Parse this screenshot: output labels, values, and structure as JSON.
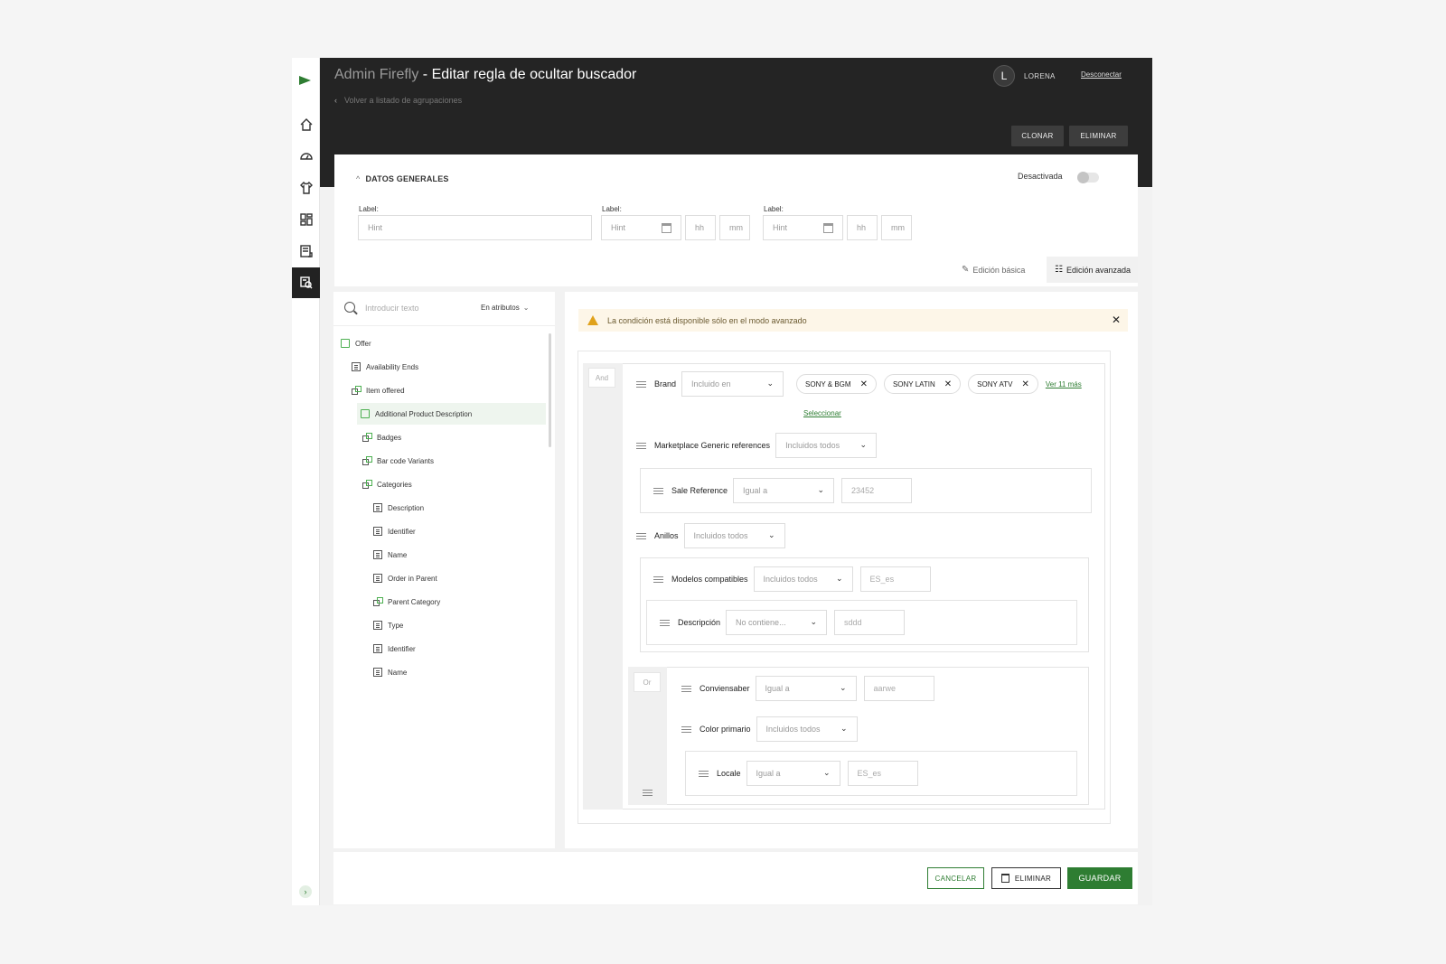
{
  "header": {
    "app_name": "Admin Firefly",
    "title": " - Editar regla de ocultar buscador",
    "back_link": "Volver a listado de agrupaciones",
    "avatar_initial": "L",
    "user_name": "LORENA",
    "logout": "Desconectar",
    "clone_button": "CLONAR",
    "delete_button": "ELIMINAR"
  },
  "general": {
    "section_title": "DATOS GENERALES",
    "toggle_label": "Desactivada",
    "toggle_on": false,
    "fields": [
      {
        "label": "Label:",
        "placeholder": "Hint"
      },
      {
        "label": "Label:",
        "placeholder": "Hint",
        "hh": "hh",
        "mm": "mm"
      },
      {
        "label": "Label:",
        "placeholder": "Hint",
        "hh": "hh",
        "mm": "mm"
      }
    ],
    "tabs": {
      "basic": "Edición básica",
      "advanced": "Edición avanzada",
      "active": "advanced"
    }
  },
  "tree": {
    "search_placeholder": "Introducir texto",
    "filter": "En atributos",
    "items": [
      {
        "label": "Offer",
        "icon": "folder-icon"
      },
      {
        "label": "Availability Ends",
        "icon": "document-icon"
      },
      {
        "label": "Item offered",
        "icon": "link-icon"
      },
      {
        "label": "Additional Product Description",
        "icon": "folder-icon",
        "selected": true
      },
      {
        "label": "Badges",
        "icon": "link-icon"
      },
      {
        "label": "Bar code Variants",
        "icon": "link-icon"
      },
      {
        "label": "Categories",
        "icon": "link-icon"
      },
      {
        "label": "Description",
        "icon": "document-icon"
      },
      {
        "label": "Identifier",
        "icon": "document-icon"
      },
      {
        "label": "Name",
        "icon": "document-icon"
      },
      {
        "label": "Order in Parent",
        "icon": "document-icon"
      },
      {
        "label": "Parent Category",
        "icon": "link-icon"
      },
      {
        "label": "Type",
        "icon": "document-icon"
      },
      {
        "label": "Identifier",
        "icon": "document-icon"
      },
      {
        "label": "Name",
        "icon": "document-icon"
      }
    ]
  },
  "conditions": {
    "alert": "La condición está disponible sólo en el modo avanzado",
    "and_label": "And",
    "or_label": "Or",
    "brand": {
      "label": "Brand",
      "operator": "Incluido en",
      "chips": [
        "SONY & BGM",
        "SONY LATIN",
        "SONY ATV"
      ],
      "more": "Ver 11 más",
      "select_link": "Seleccionar"
    },
    "marketplace": {
      "label": "Marketplace Generic references",
      "operator": "Incluidos todos"
    },
    "sale_reference": {
      "label": "Sale Reference",
      "operator": "Igual a",
      "value": "23452"
    },
    "anillos": {
      "label": "Anillos",
      "operator": "Incluidos todos"
    },
    "modelos": {
      "label": "Modelos compatibles",
      "operator": "Incluidos todos",
      "value": "ES_es"
    },
    "descripcion": {
      "label": "Descripción",
      "operator": "No contiene...",
      "value": "sddd"
    },
    "conviensaber": {
      "label": "Conviensaber",
      "operator": "Igual a",
      "value": "aarwe"
    },
    "color": {
      "label": "Color primario",
      "operator": "Incluidos todos"
    },
    "locale": {
      "label": "Locale",
      "operator": "Igual a",
      "value": "ES_es"
    }
  },
  "footer": {
    "cancel": "CANCELAR",
    "delete": "ELIMINAR",
    "save": "GUARDAR"
  },
  "colors": {
    "accent": "#2e7d32",
    "header_bg": "#242424",
    "alert_bg": "#fdf6e8"
  }
}
